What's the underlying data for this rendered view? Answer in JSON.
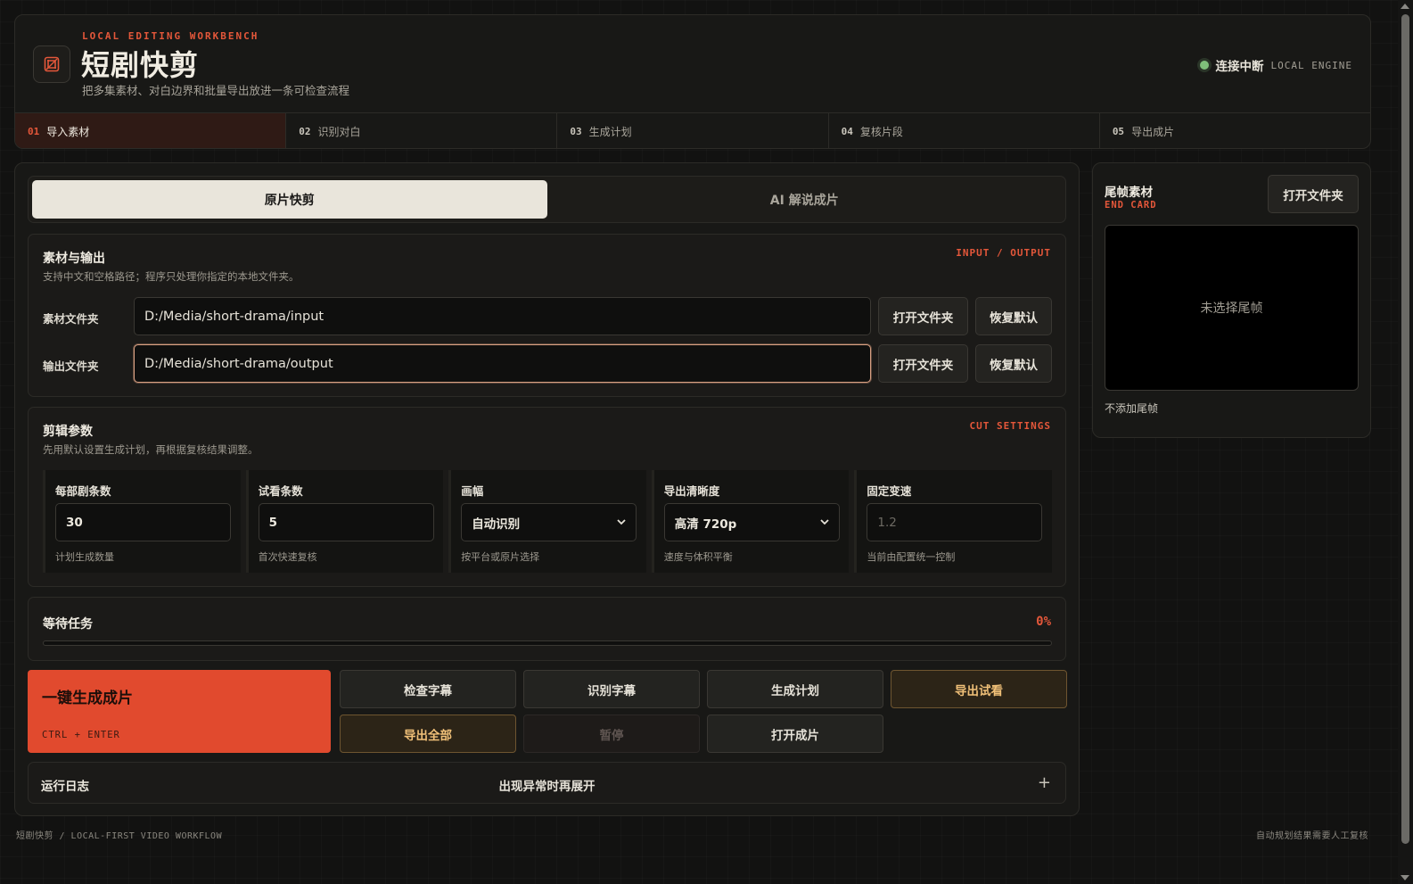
{
  "header": {
    "eyebrow": "LOCAL EDITING WORKBENCH",
    "title": "短剧快剪",
    "subtitle": "把多集素材、对白边界和批量导出放进一条可检查流程",
    "status_text": "连接中断",
    "engine_label": "LOCAL ENGINE"
  },
  "steps": [
    {
      "num": "01",
      "label": "导入素材",
      "active": true
    },
    {
      "num": "02",
      "label": "识别对白",
      "active": false
    },
    {
      "num": "03",
      "label": "生成计划",
      "active": false
    },
    {
      "num": "04",
      "label": "复核片段",
      "active": false
    },
    {
      "num": "05",
      "label": "导出成片",
      "active": false
    }
  ],
  "modes": {
    "original": "原片快剪",
    "ai": "AI 解说成片",
    "selected": "original"
  },
  "io": {
    "title": "素材与输出",
    "subtitle": "支持中文和空格路径；程序只处理你指定的本地文件夹。",
    "tag": "INPUT / OUTPUT",
    "input_label": "素材文件夹",
    "input_value": "D:/Media/short-drama/input",
    "output_label": "输出文件夹",
    "output_value": "D:/Media/short-drama/output",
    "open_label": "打开文件夹",
    "reset_label": "恢复默认"
  },
  "cut": {
    "title": "剪辑参数",
    "subtitle": "先用默认设置生成计划，再根据复核结果调整。",
    "tag": "CUT SETTINGS",
    "params": [
      {
        "label": "每部剧条数",
        "value": "30",
        "hint": "计划生成数量"
      },
      {
        "label": "试看条数",
        "value": "5",
        "hint": "首次快速复核"
      },
      {
        "label": "画幅",
        "value": "自动识别",
        "hint": "按平台或原片选择"
      },
      {
        "label": "导出清晰度",
        "value": "高清 720p",
        "hint": "速度与体积平衡"
      },
      {
        "label": "固定变速",
        "value": "1.2",
        "hint": "当前由配置统一控制"
      }
    ]
  },
  "progress": {
    "title": "等待任务",
    "percent_label": "0%",
    "percent": 0
  },
  "actions": {
    "primary_label": "一键生成成片",
    "primary_hint": "CTRL + ENTER",
    "check_subtitles": "检查字幕",
    "recognize_subtitles": "识别字幕",
    "generate_plan": "生成计划",
    "export_preview": "导出试看",
    "export_all": "导出全部",
    "pause": "暂停",
    "open_output": "打开成片"
  },
  "log": {
    "title": "运行日志",
    "hint": "出现异常时再展开",
    "toggle": "+"
  },
  "endcard": {
    "title": "尾帧素材",
    "tag": "END CARD",
    "open_label": "打开文件夹",
    "preview_text": "未选择尾帧",
    "note": "不添加尾帧"
  },
  "footer": {
    "left": "短剧快剪 / LOCAL-FIRST VIDEO WORKFLOW",
    "right": "自动规划结果需要人工复核"
  },
  "colors": {
    "accent": "#e4573a",
    "warm": "#f0c078",
    "status_ok": "#7fbf7a"
  },
  "icons": {
    "logo": "crop-icon",
    "status": "status-dot-icon",
    "select": "chevron-down-icon"
  }
}
